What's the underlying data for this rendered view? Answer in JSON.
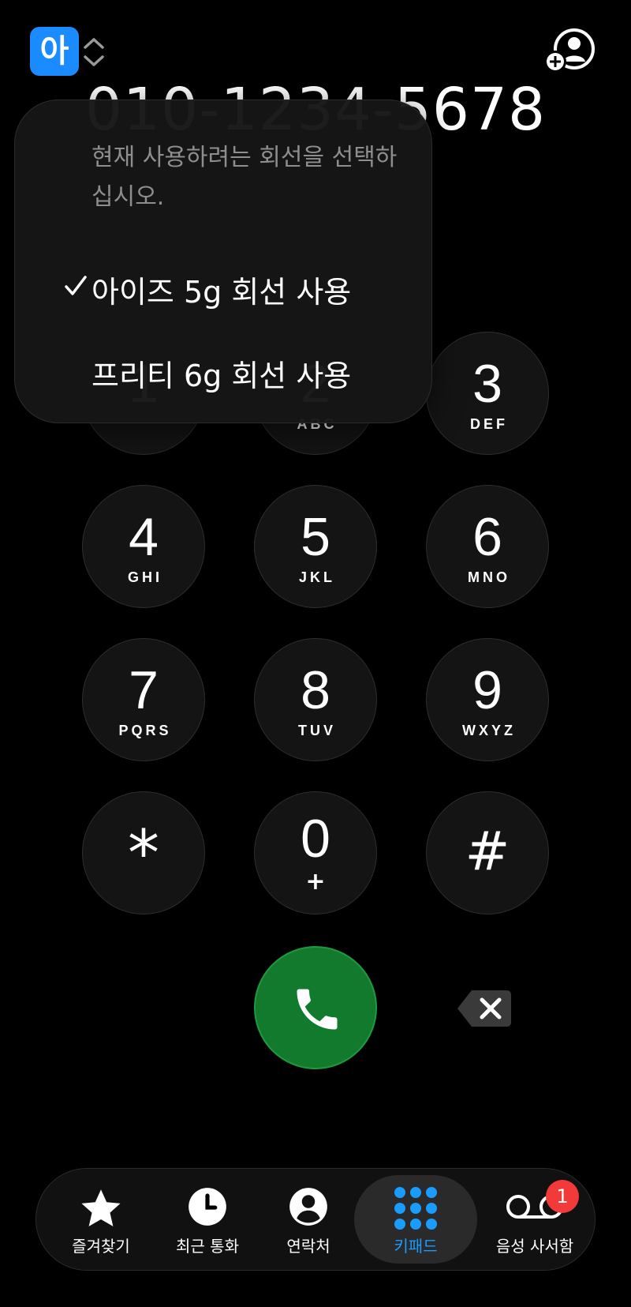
{
  "header": {
    "line_badge": "아",
    "add_contact_icon": "person-add-icon"
  },
  "dialer": {
    "number": "010-1234-5678"
  },
  "line_popup": {
    "prompt": "현재 사용하려는 회선을 선택하십시오.",
    "options": [
      {
        "label": "아이즈 5g 회선 사용",
        "selected": true
      },
      {
        "label": "프리티 6g 회선 사용",
        "selected": false
      }
    ]
  },
  "keypad": {
    "keys": [
      {
        "digit": "1",
        "letters": ""
      },
      {
        "digit": "2",
        "letters": "ABC"
      },
      {
        "digit": "3",
        "letters": "DEF"
      },
      {
        "digit": "4",
        "letters": "GHI"
      },
      {
        "digit": "5",
        "letters": "JKL"
      },
      {
        "digit": "6",
        "letters": "MNO"
      },
      {
        "digit": "7",
        "letters": "PQRS"
      },
      {
        "digit": "8",
        "letters": "TUV"
      },
      {
        "digit": "9",
        "letters": "WXYZ"
      },
      {
        "digit": "*",
        "letters": ""
      },
      {
        "digit": "0",
        "letters": "+"
      },
      {
        "digit": "#",
        "letters": ""
      }
    ]
  },
  "tabs": [
    {
      "label": "즐겨찾기",
      "icon": "star-icon"
    },
    {
      "label": "최근 통화",
      "icon": "clock-icon"
    },
    {
      "label": "연락처",
      "icon": "contact-icon"
    },
    {
      "label": "키패드",
      "icon": "keypad-icon",
      "active": true
    },
    {
      "label": "음성 사서함",
      "icon": "voicemail-icon"
    }
  ],
  "voicemail_badge": "1",
  "colors": {
    "accent": "#1a8cff",
    "call_green": "#127a2c",
    "badge_red": "#f23a3a"
  }
}
